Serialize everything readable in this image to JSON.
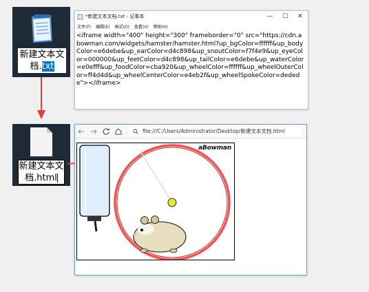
{
  "desktop": {
    "icon1": {
      "name_main": "新建文本文",
      "name_line2": "档.",
      "name_ext": "txt"
    },
    "icon2": {
      "name_main": "新建文本文",
      "name_line2": "档.html"
    }
  },
  "notepad": {
    "title": "*新建文本文档.txt - 记事本",
    "menu": [
      "文件(F)",
      "编辑(E)",
      "格式(O)",
      "查看(V)",
      "帮助(H)"
    ],
    "content": "<iframe width=\"400\" height=\"300\" frameborder=\"0\" src=\"https://cdn.abowman.com/widgets/hamster/hamster.html?up_bgColor=ffffff&up_bodyColor=e6debe&up_earColor=d4c898&up_snoutColor=f7f4e9&up_eyeColor=000000&up_feetColor=d4c898&up_tailColor=e6debe&up_waterColor=e0efff&up_foodColor=cba920&up_wheelColor=ffffff&up_wheelOuterColor=ff4d4d&up_wheelCenterColor=e4eb2f&up_wheelSpokeColor=dedede\"></iframe>"
  },
  "browser": {
    "url": "file:///C:/Users/Administrator/Desktop/新建文本文档.html",
    "widget_brand": "aBowman"
  },
  "colors": {
    "wheel_outer": "#ff4d4d",
    "wheel_center": "#e4eb2f",
    "water": "#e0efff",
    "hamster_body": "#e6debe",
    "arrow": "#e23b3b",
    "desktop_tile": "#1e2b36"
  }
}
